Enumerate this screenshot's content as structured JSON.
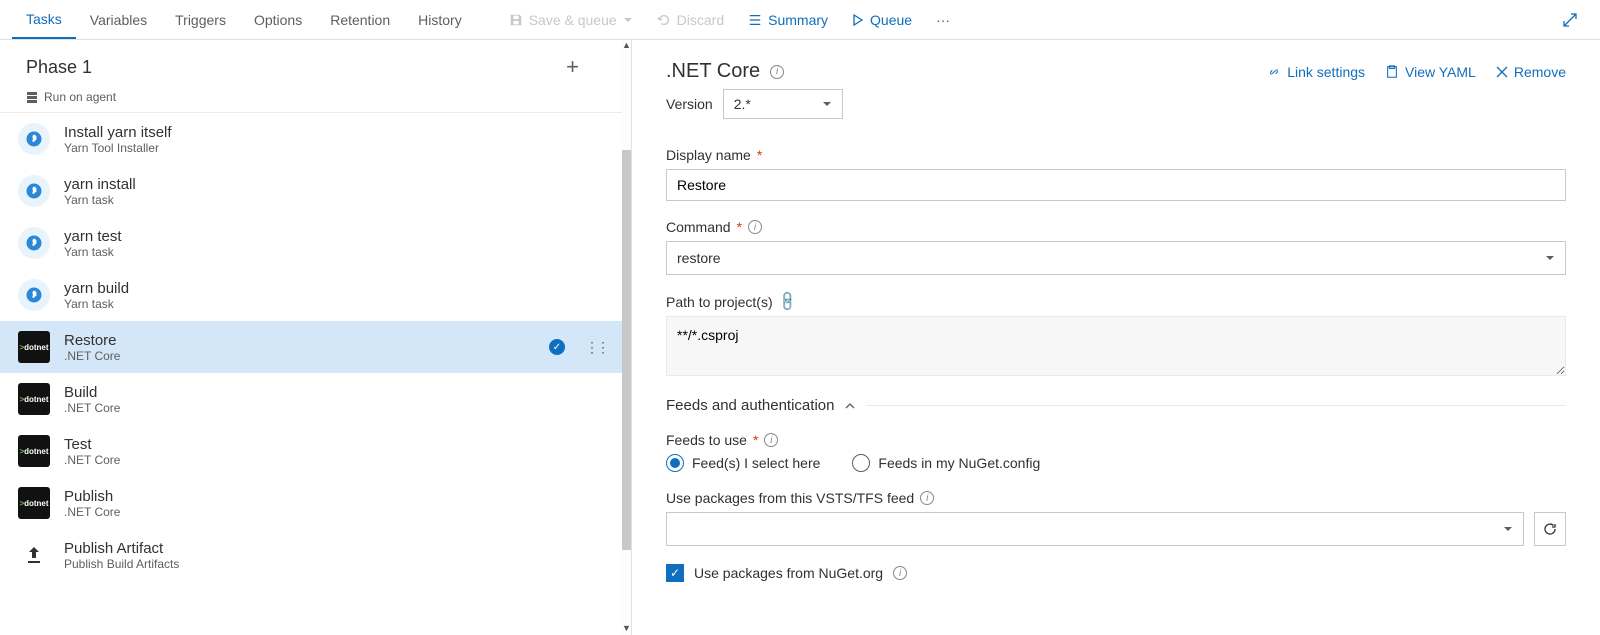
{
  "topTabs": [
    "Tasks",
    "Variables",
    "Triggers",
    "Options",
    "Retention",
    "History"
  ],
  "topTabActive": 0,
  "tools": {
    "save": "Save & queue",
    "discard": "Discard",
    "summary": "Summary",
    "queue": "Queue"
  },
  "phase": {
    "title": "Phase 1",
    "subtitle": "Run on agent"
  },
  "tasks": [
    {
      "name": "Install yarn itself",
      "sub": "Yarn Tool Installer",
      "icon": "yarn"
    },
    {
      "name": "yarn install",
      "sub": "Yarn task",
      "icon": "yarn"
    },
    {
      "name": "yarn test",
      "sub": "Yarn task",
      "icon": "yarn"
    },
    {
      "name": "yarn build",
      "sub": "Yarn task",
      "icon": "yarn"
    },
    {
      "name": "Restore",
      "sub": ".NET Core",
      "icon": "dotnet",
      "selected": true
    },
    {
      "name": "Build",
      "sub": ".NET Core",
      "icon": "dotnet"
    },
    {
      "name": "Test",
      "sub": ".NET Core",
      "icon": "dotnet"
    },
    {
      "name": "Publish",
      "sub": ".NET Core",
      "icon": "dotnet"
    },
    {
      "name": "Publish Artifact",
      "sub": "Publish Build Artifacts",
      "icon": "pkg"
    }
  ],
  "panel": {
    "title": ".NET Core",
    "versionLabel": "Version",
    "versionValue": "2.*",
    "actions": {
      "link": "Link settings",
      "yaml": "View YAML",
      "remove": "Remove"
    },
    "displayNameLabel": "Display name",
    "displayNameValue": "Restore",
    "commandLabel": "Command",
    "commandValue": "restore",
    "pathLabel": "Path to project(s)",
    "pathValue": "**/*.csproj",
    "feedsSection": "Feeds and authentication",
    "feedsToUseLabel": "Feeds to use",
    "radio1": "Feed(s) I select here",
    "radio2": "Feeds in my NuGet.config",
    "vstsFeedLabel": "Use packages from this VSTS/TFS feed",
    "nugetOrgLabel": "Use packages from NuGet.org"
  }
}
